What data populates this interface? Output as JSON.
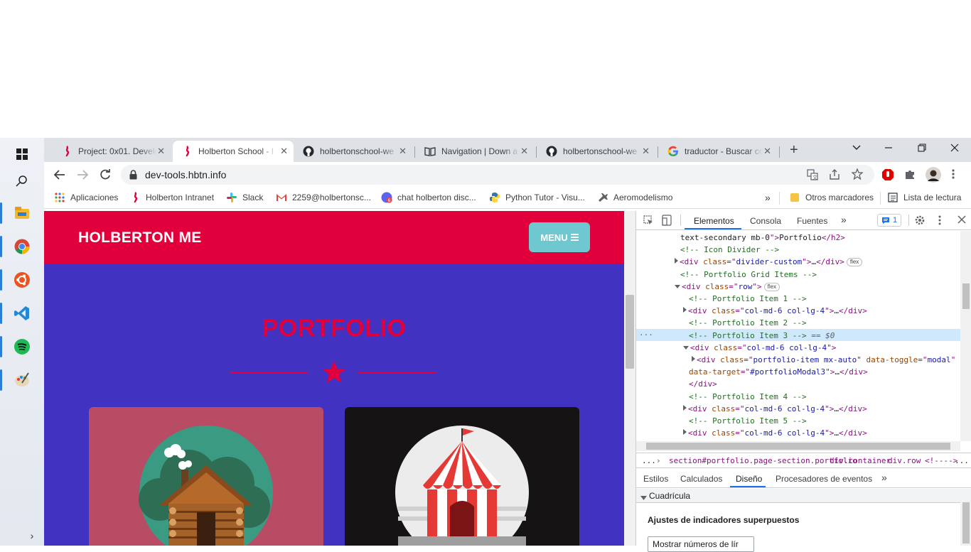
{
  "browser": {
    "tabs": [
      {
        "title": "Project: 0x01. Develo",
        "icon": "holberton-icon"
      },
      {
        "title": "Holberton School - I",
        "icon": "holberton-icon"
      },
      {
        "title": "holbertonschool-we",
        "icon": "github-icon"
      },
      {
        "title": "Navigation | Down a",
        "icon": "book-icon"
      },
      {
        "title": "holbertonschool-we",
        "icon": "github-icon"
      },
      {
        "title": "traductor - Buscar co",
        "icon": "google-icon"
      }
    ],
    "active_tab": 1,
    "url": "dev-tools.hbtn.info",
    "bookmarks": [
      {
        "label": "Aplicaciones",
        "icon": "apps-grid-icon"
      },
      {
        "label": "Holberton Intranet",
        "icon": "holberton-icon"
      },
      {
        "label": "Slack",
        "icon": "slack-icon"
      },
      {
        "label": "2259@holbertonsc...",
        "icon": "gmail-icon"
      },
      {
        "label": "chat holberton disc...",
        "icon": "discord-icon"
      },
      {
        "label": "Python Tutor - Visu...",
        "icon": "python-icon"
      },
      {
        "label": "Aeromodelismo",
        "icon": "plane-icon"
      }
    ],
    "other_bookmarks": "Otros marcadores",
    "reading_list": "Lista de lectura",
    "overflow": "»"
  },
  "page": {
    "brand": "HOLBERTON ME",
    "menu_label": "MENU",
    "section_title": "PORTFOLIO",
    "colors": {
      "nav": "#e2003c",
      "bg": "#4232c2",
      "menu": "#6fc8cf"
    }
  },
  "devtools": {
    "tabs": [
      "Elementos",
      "Consola",
      "Fuentes"
    ],
    "issues_count": "1",
    "code_lines": [
      {
        "indent": 0,
        "parts": [
          [
            "txt",
            "text-secondary mb-0"
          ],
          [
            "tag",
            "\">"
          ],
          [
            "txt",
            "Portfolio"
          ],
          [
            "tag",
            "</h2>"
          ]
        ],
        "raw": "text-secondary mb-0\">Portfolio</h2>"
      },
      {
        "indent": 0,
        "parts": [
          [
            "com",
            "<!-- Icon Divider -->"
          ]
        ]
      },
      {
        "indent": 0,
        "tri": "r",
        "parts": [
          [
            "tag",
            "<div "
          ],
          [
            "attr",
            "class"
          ],
          [
            "tag",
            "=\""
          ],
          [
            "val",
            "divider-custom"
          ],
          [
            "tag",
            "\">"
          ],
          [
            "txt",
            "…"
          ],
          [
            "tag",
            "</div>"
          ]
        ],
        "badge": "flex"
      },
      {
        "indent": 0,
        "parts": [
          [
            "com",
            "<!-- Portfolio Grid Items -->"
          ]
        ]
      },
      {
        "indent": 0,
        "tri": "d",
        "parts": [
          [
            "tag",
            "<div "
          ],
          [
            "attr",
            "class"
          ],
          [
            "tag",
            "=\""
          ],
          [
            "val",
            "row"
          ],
          [
            "tag",
            "\">"
          ]
        ],
        "badge": "flex"
      },
      {
        "indent": 1,
        "parts": [
          [
            "com",
            "<!-- Portfolio Item 1 -->"
          ]
        ]
      },
      {
        "indent": 1,
        "tri": "r",
        "parts": [
          [
            "tag",
            "<div "
          ],
          [
            "attr",
            "class"
          ],
          [
            "tag",
            "=\""
          ],
          [
            "val",
            "col-md-6 col-lg-4"
          ],
          [
            "tag",
            "\">"
          ],
          [
            "txt",
            "…"
          ],
          [
            "tag",
            "</div>"
          ]
        ]
      },
      {
        "indent": 1,
        "parts": [
          [
            "com",
            "<!-- Portfolio Item 2 -->"
          ]
        ]
      },
      {
        "indent": 1,
        "sel": true,
        "parts": [
          [
            "com",
            "<!-- Portfolio Item 3 -->"
          ],
          [
            "eq",
            " == $0"
          ]
        ]
      },
      {
        "indent": 1,
        "tri": "d",
        "parts": [
          [
            "tag",
            "<div "
          ],
          [
            "attr",
            "class"
          ],
          [
            "tag",
            "=\""
          ],
          [
            "val",
            "col-md-6 col-lg-4"
          ],
          [
            "tag",
            "\">"
          ]
        ]
      },
      {
        "indent": 2,
        "tri": "r",
        "parts": [
          [
            "tag",
            "<div "
          ],
          [
            "attr",
            "class"
          ],
          [
            "tag",
            "=\""
          ],
          [
            "val",
            "portfolio-item mx-auto"
          ],
          [
            "tag",
            "\" "
          ],
          [
            "attr",
            "data-toggle"
          ],
          [
            "tag",
            "=\""
          ],
          [
            "val",
            "modal"
          ],
          [
            "tag",
            "\""
          ]
        ]
      },
      {
        "indent": 1,
        "parts": [
          [
            "attr",
            "data-target"
          ],
          [
            "tag",
            "=\""
          ],
          [
            "val",
            "#portfolioModal3"
          ],
          [
            "tag",
            "\">"
          ],
          [
            "txt",
            "…"
          ],
          [
            "tag",
            "</div>"
          ]
        ]
      },
      {
        "indent": 1,
        "parts": [
          [
            "tag",
            "</div>"
          ]
        ]
      },
      {
        "indent": 1,
        "parts": [
          [
            "com",
            "<!-- Portfolio Item 4 -->"
          ]
        ]
      },
      {
        "indent": 1,
        "tri": "r",
        "parts": [
          [
            "tag",
            "<div "
          ],
          [
            "attr",
            "class"
          ],
          [
            "tag",
            "=\""
          ],
          [
            "val",
            "col-md-6 col-lg-4"
          ],
          [
            "tag",
            "\">"
          ],
          [
            "txt",
            "…"
          ],
          [
            "tag",
            "</div>"
          ]
        ]
      },
      {
        "indent": 1,
        "parts": [
          [
            "com",
            "<!-- Portfolio Item 5 -->"
          ]
        ]
      },
      {
        "indent": 1,
        "tri": "r",
        "parts": [
          [
            "tag",
            "<div "
          ],
          [
            "attr",
            "class"
          ],
          [
            "tag",
            "=\""
          ],
          [
            "val",
            "col-md-6 col-lg-4"
          ],
          [
            "tag",
            "\">"
          ],
          [
            "txt",
            "…"
          ],
          [
            "tag",
            "</div>"
          ]
        ]
      }
    ],
    "breadcrumb": [
      "...",
      "section#portfolio.page-section.portfolio",
      "div.container",
      "div.row",
      "<!---->",
      "..."
    ],
    "sub_tabs": [
      "Estilos",
      "Calculados",
      "Diseño",
      "Procesadores de eventos"
    ],
    "grid_section": "Cuadrícula",
    "overlay_title": "Ajustes de indicadores superpuestos",
    "select_value": "Mostrar números de lír"
  }
}
